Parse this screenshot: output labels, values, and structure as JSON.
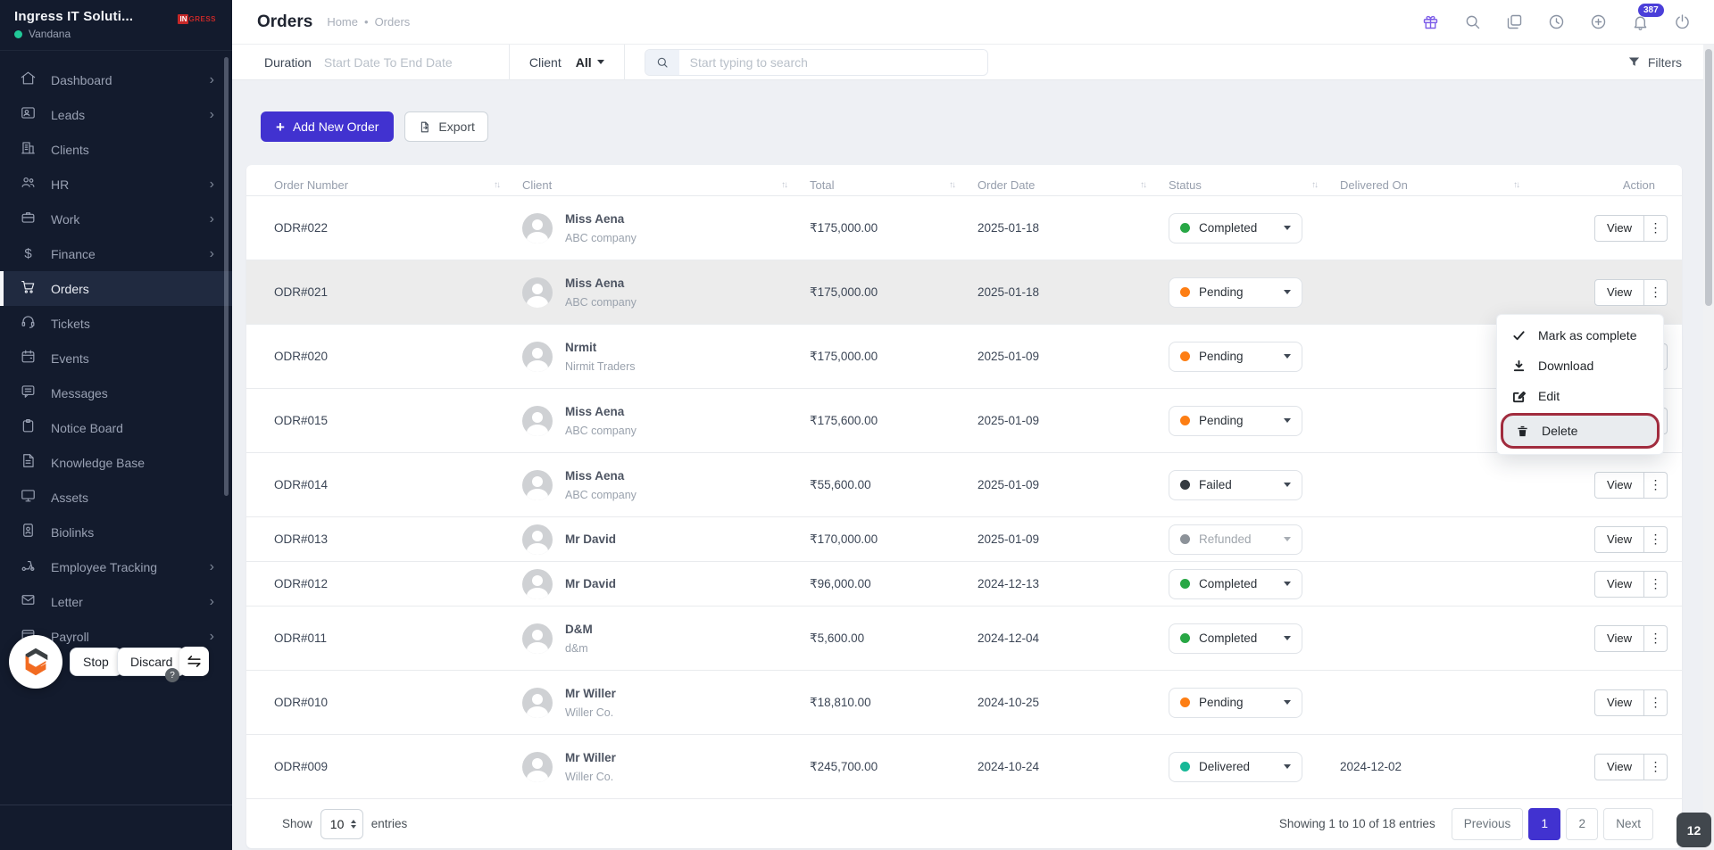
{
  "sidebar": {
    "brand": {
      "name": "Ingress IT Soluti...",
      "user": "Vandana",
      "logo_in": "IN",
      "logo_rest": "GRESS"
    },
    "items": [
      {
        "label": "Dashboard",
        "icon": "home-icon",
        "chevron": true
      },
      {
        "label": "Leads",
        "icon": "id-card-icon",
        "chevron": true
      },
      {
        "label": "Clients",
        "icon": "building-icon",
        "chevron": false
      },
      {
        "label": "HR",
        "icon": "users-icon",
        "chevron": true
      },
      {
        "label": "Work",
        "icon": "briefcase-icon",
        "chevron": true
      },
      {
        "label": "Finance",
        "icon": "dollar-icon",
        "chevron": true
      },
      {
        "label": "Orders",
        "icon": "cart-icon",
        "chevron": false,
        "active": true
      },
      {
        "label": "Tickets",
        "icon": "headset-icon",
        "chevron": false
      },
      {
        "label": "Events",
        "icon": "calendar-icon",
        "chevron": false
      },
      {
        "label": "Messages",
        "icon": "chat-icon",
        "chevron": false
      },
      {
        "label": "Notice Board",
        "icon": "clipboard-icon",
        "chevron": false
      },
      {
        "label": "Knowledge Base",
        "icon": "document-icon",
        "chevron": false
      },
      {
        "label": "Assets",
        "icon": "monitor-icon",
        "chevron": false
      },
      {
        "label": "Biolinks",
        "icon": "contact-card-icon",
        "chevron": false
      },
      {
        "label": "Employee Tracking",
        "icon": "scooter-icon",
        "chevron": true
      },
      {
        "label": "Letter",
        "icon": "envelope-icon",
        "chevron": true
      },
      {
        "label": "Payroll",
        "icon": "wallet-icon",
        "chevron": true
      }
    ]
  },
  "header": {
    "title": "Orders",
    "breadcrumb_home": "Home",
    "breadcrumb_sep": "•",
    "breadcrumb_current": "Orders",
    "notification_count": "387"
  },
  "filters": {
    "duration_label": "Duration",
    "duration_placeholder": "Start Date To End Date",
    "client_label": "Client",
    "client_value": "All",
    "search_placeholder": "Start typing to search",
    "filters_label": "Filters"
  },
  "toolbar": {
    "add_label": "Add New Order",
    "export_label": "Export"
  },
  "table": {
    "columns": [
      "Order Number",
      "Client",
      "Total",
      "Order Date",
      "Status",
      "Delivered On",
      "Action"
    ],
    "view_label": "View",
    "rows": [
      {
        "order": "ODR#022",
        "client": "Miss Aena",
        "company": "ABC company",
        "total": "₹175,000.00",
        "date": "2025-01-18",
        "status": "Completed",
        "delivered": ""
      },
      {
        "order": "ODR#021",
        "client": "Miss Aena",
        "company": "ABC company",
        "total": "₹175,000.00",
        "date": "2025-01-18",
        "status": "Pending",
        "delivered": ""
      },
      {
        "order": "ODR#020",
        "client": "Nrmit",
        "company": "Nirmit Traders",
        "total": "₹175,000.00",
        "date": "2025-01-09",
        "status": "Pending",
        "delivered": ""
      },
      {
        "order": "ODR#015",
        "client": "Miss Aena",
        "company": "ABC company",
        "total": "₹175,600.00",
        "date": "2025-01-09",
        "status": "Pending",
        "delivered": ""
      },
      {
        "order": "ODR#014",
        "client": "Miss Aena",
        "company": "ABC company",
        "total": "₹55,600.00",
        "date": "2025-01-09",
        "status": "Failed",
        "delivered": ""
      },
      {
        "order": "ODR#013",
        "client": "Mr David",
        "company": "",
        "total": "₹170,000.00",
        "date": "2025-01-09",
        "status": "Refunded",
        "delivered": ""
      },
      {
        "order": "ODR#012",
        "client": "Mr David",
        "company": "",
        "total": "₹96,000.00",
        "date": "2024-12-13",
        "status": "Completed",
        "delivered": ""
      },
      {
        "order": "ODR#011",
        "client": "D&M",
        "company": "d&m",
        "total": "₹5,600.00",
        "date": "2024-12-04",
        "status": "Completed",
        "delivered": ""
      },
      {
        "order": "ODR#010",
        "client": "Mr Willer",
        "company": "Willer Co.",
        "total": "₹18,810.00",
        "date": "2024-10-25",
        "status": "Pending",
        "delivered": ""
      },
      {
        "order": "ODR#009",
        "client": "Mr Willer",
        "company": "Willer Co.",
        "total": "₹245,700.00",
        "date": "2024-10-24",
        "status": "Delivered",
        "delivered": "2024-12-02"
      }
    ]
  },
  "context_menu": {
    "items": [
      {
        "label": "Mark as complete"
      },
      {
        "label": "Download"
      },
      {
        "label": "Edit"
      },
      {
        "label": "Delete",
        "highlighted": true
      }
    ]
  },
  "footer": {
    "show_label": "Show",
    "page_size": "10",
    "entries_label": "entries",
    "summary": "Showing 1 to 10 of 18 entries",
    "prev_label": "Previous",
    "page_1": "1",
    "page_2": "2",
    "next_label": "Next",
    "active_page": "1"
  },
  "overlay": {
    "stop_label": "Stop",
    "discard_label": "Discard",
    "help": "?",
    "step_badge": "12"
  },
  "icons": {
    "more": "⋮",
    "chevron": "›",
    "sort": "↑↓",
    "plus": "+"
  },
  "colors": {
    "accent": "#4132d0",
    "sidebar_bg": "#131b2d",
    "online": "#21c998",
    "gift": "#7c5ce8",
    "notification_badge": "#4b3fd9",
    "delete_highlight_border": "#a12c3e",
    "status": {
      "Completed": "#28a745",
      "Pending": "#fd7e14",
      "Failed": "#343a40",
      "Refunded": "#8c9299",
      "Delivered": "#17b897"
    }
  }
}
